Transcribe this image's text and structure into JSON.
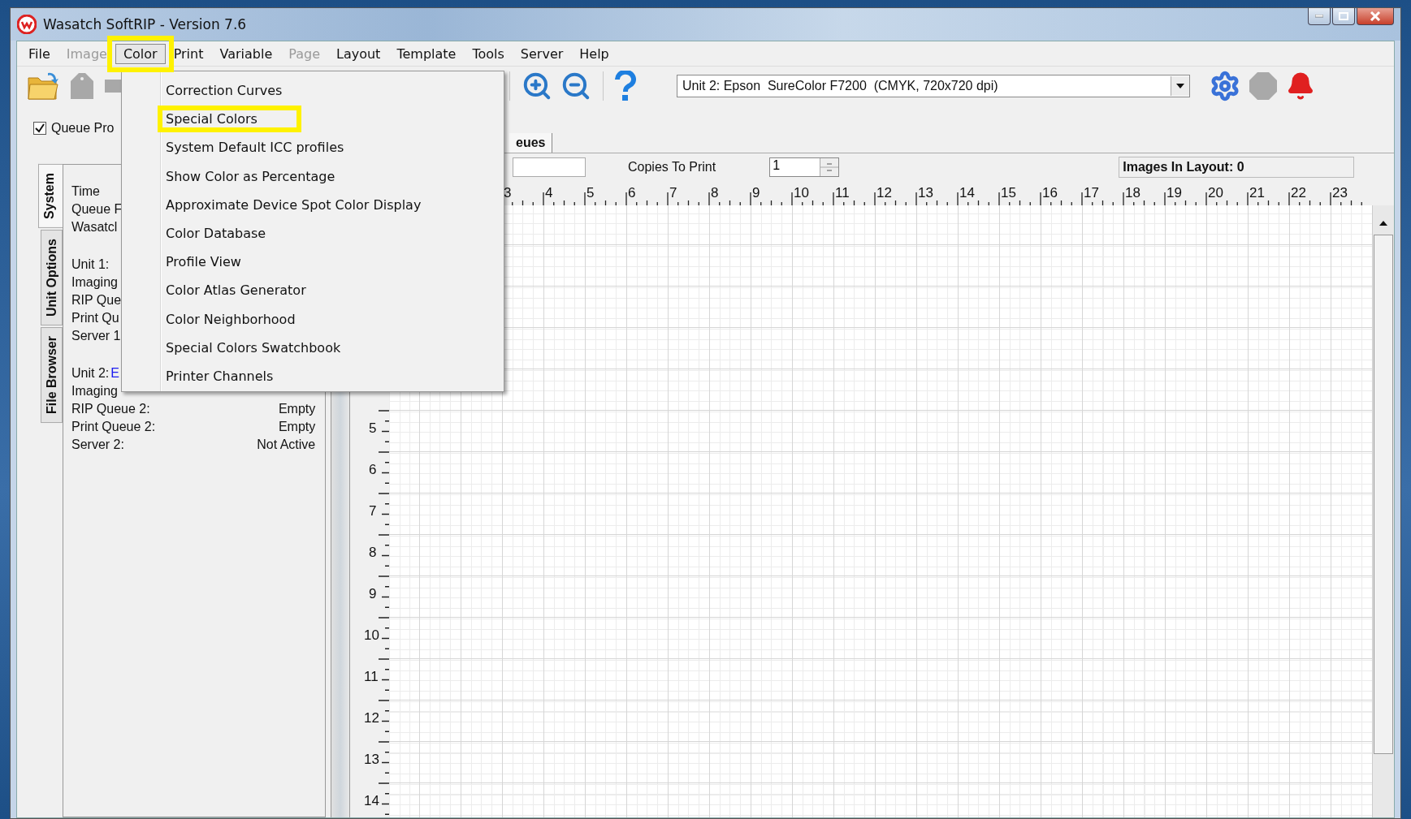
{
  "window": {
    "title": "Wasatch SoftRIP - Version 7.6"
  },
  "menu_bar": [
    {
      "label": "File",
      "disabled": false,
      "selected": false
    },
    {
      "label": "Image",
      "disabled": true,
      "selected": false
    },
    {
      "label": "Color",
      "disabled": false,
      "selected": true
    },
    {
      "label": "Print",
      "disabled": false,
      "selected": false
    },
    {
      "label": "Variable",
      "disabled": false,
      "selected": false
    },
    {
      "label": "Page",
      "disabled": true,
      "selected": false
    },
    {
      "label": "Layout",
      "disabled": false,
      "selected": false
    },
    {
      "label": "Template",
      "disabled": false,
      "selected": false
    },
    {
      "label": "Tools",
      "disabled": false,
      "selected": false
    },
    {
      "label": "Server",
      "disabled": false,
      "selected": false
    },
    {
      "label": "Help",
      "disabled": false,
      "selected": false
    }
  ],
  "color_menu": {
    "items": [
      {
        "label": "Correction Curves",
        "highlighted": false
      },
      {
        "label": "Special Colors",
        "highlighted": true
      },
      {
        "label": "System Default ICC profiles",
        "highlighted": false
      },
      {
        "label": "Show Color as Percentage",
        "highlighted": false
      },
      {
        "label": "Approximate Device Spot Color Display",
        "highlighted": false
      },
      {
        "label": "Color Database",
        "highlighted": false
      },
      {
        "label": "Profile View",
        "highlighted": false
      },
      {
        "label": "Color Atlas Generator",
        "highlighted": false
      },
      {
        "label": "Color Neighborhood",
        "highlighted": false
      },
      {
        "label": "Special Colors Swatchbook",
        "highlighted": false
      },
      {
        "label": "Printer Channels",
        "highlighted": false
      }
    ]
  },
  "printer_select": {
    "value": "Unit 2: Epson  SureColor F7200  (CMYK, 720x720 dpi)"
  },
  "queue_checkbox": {
    "label": "Queue Pro",
    "checked": true
  },
  "side_tabs": [
    {
      "label": "System",
      "selected": true
    },
    {
      "label": "Unit Options",
      "selected": false
    },
    {
      "label": "File Browser",
      "selected": false
    }
  ],
  "info_groups": [
    [
      {
        "label": "Time"
      },
      {
        "label": "Queue F"
      },
      {
        "label": "Wasatcl"
      }
    ],
    [
      {
        "label": "Unit 1:"
      },
      {
        "label": "Imaging"
      },
      {
        "label": "RIP Que"
      },
      {
        "label": "Print Qu"
      },
      {
        "label": "Server 1"
      }
    ],
    [
      {
        "label": "Unit 2:",
        "link": "E"
      },
      {
        "label": "Imaging"
      },
      {
        "label": "RIP Queue 2:",
        "value": "Empty"
      },
      {
        "label": "Print Queue 2:",
        "value": "Empty"
      },
      {
        "label": "Server 2:",
        "value": "Not Active"
      }
    ]
  ],
  "layout_tabs": [
    {
      "label": "eues",
      "selected": true
    }
  ],
  "copies": {
    "label": "Copies To Print",
    "value": "1"
  },
  "images_in_layout": "Images In Layout: 0",
  "ruler_h": [
    "3",
    "4",
    "5",
    "6",
    "7",
    "8",
    "9",
    "10",
    "11",
    "12",
    "13",
    "14",
    "15",
    "16",
    "17",
    "18",
    "19",
    "20",
    "21",
    "22",
    "23"
  ],
  "ruler_v": [
    "5",
    "6",
    "7",
    "8",
    "9",
    "10",
    "11",
    "12",
    "13",
    "14"
  ]
}
